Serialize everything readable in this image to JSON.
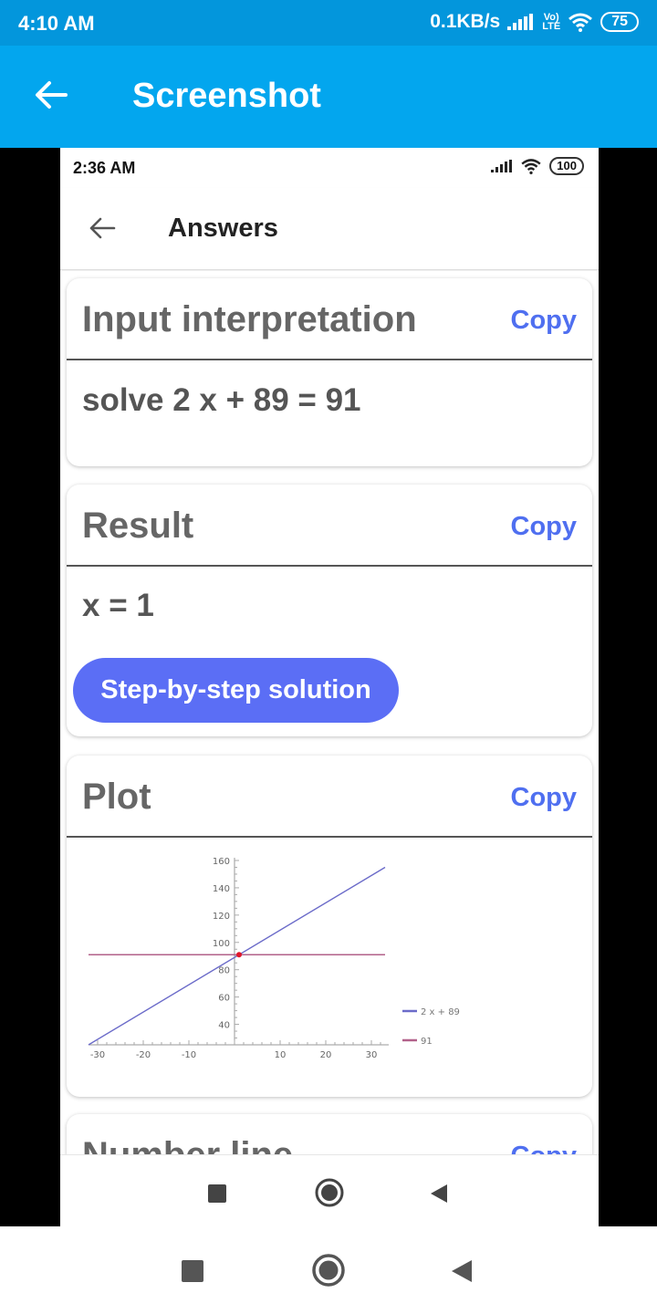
{
  "outer_status": {
    "time": "4:10 AM",
    "speed": "0.1KB/s",
    "volte_top": "Vo)",
    "volte_bottom": "LTE",
    "battery": "75"
  },
  "outer_appbar": {
    "title": "Screenshot",
    "back_icon": "arrow-left-icon"
  },
  "inner_status": {
    "time": "2:36 AM",
    "battery": "100"
  },
  "inner_appbar": {
    "title": "Answers",
    "back_icon": "arrow-left-icon"
  },
  "cards": {
    "input": {
      "title": "Input interpretation",
      "copy": "Copy",
      "text": "solve 2 x + 89 = 91"
    },
    "result": {
      "title": "Result",
      "copy": "Copy",
      "text": "x = 1",
      "step_button": "Step-by-step solution"
    },
    "plot": {
      "title": "Plot",
      "copy": "Copy"
    },
    "number_line": {
      "title": "Number line",
      "copy": "Copy"
    }
  },
  "colors": {
    "outer_status_bg": "#0396dc",
    "outer_appbar_bg": "#03a6ee",
    "accent": "#4f6ff0",
    "button_bg": "#5b6ef5",
    "line_series": "#6b6bc9",
    "const_series": "#b2618a",
    "intersection": "#e0162b"
  },
  "chart_data": {
    "type": "line",
    "xlim": [
      -32,
      33
    ],
    "ylim": [
      25,
      162
    ],
    "x_ticks": [
      "-30",
      "-20",
      "-10",
      "10",
      "20",
      "30"
    ],
    "y_ticks": [
      "40",
      "60",
      "80",
      "100",
      "120",
      "140",
      "160"
    ],
    "series": [
      {
        "name": "2 x + 89",
        "x": [
          -32,
          33
        ],
        "y": [
          25,
          155
        ],
        "color": "#6b6bc9"
      },
      {
        "name": "91",
        "x": [
          -32,
          33
        ],
        "y": [
          91,
          91
        ],
        "color": "#b2618a"
      }
    ],
    "points": [
      {
        "x": 1,
        "y": 91,
        "color": "#e0162b"
      }
    ],
    "legend": "bottom-right",
    "grid": false
  },
  "inner_nav": [
    "stop-icon",
    "home-icon",
    "back-icon"
  ],
  "outer_nav": [
    "stop-icon",
    "home-icon",
    "back-icon"
  ]
}
